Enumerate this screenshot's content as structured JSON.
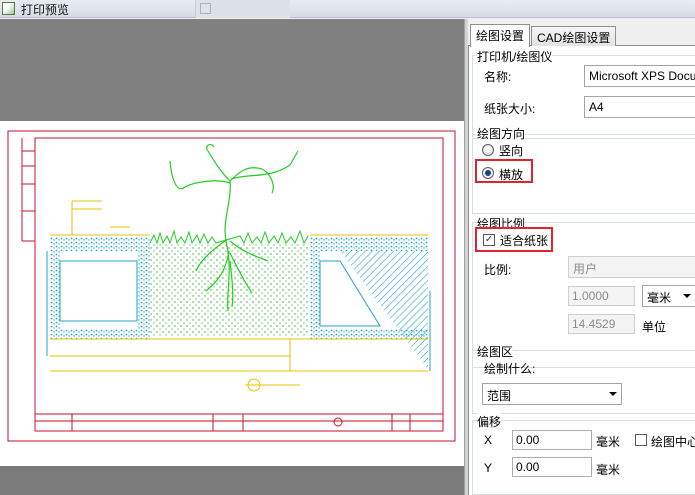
{
  "window": {
    "title": "打印预览",
    "ghost_title": ""
  },
  "tabs": [
    {
      "label": "绘图设置"
    },
    {
      "label": "CAD绘图设置"
    }
  ],
  "printer": {
    "group_title": "打印机/绘图仪",
    "name_label": "名称:",
    "name_value": "Microsoft XPS Docu",
    "paper_label": "纸张大小:",
    "paper_value": "A4"
  },
  "orientation": {
    "group_title": "绘图方向",
    "portrait_label": "竖向",
    "landscape_label": "横放",
    "selected": "横放"
  },
  "scale": {
    "group_title": "绘图比例",
    "fit_label": "适合纸张",
    "fit_checked": true,
    "ratio_label": "比例:",
    "ratio_value": "用户",
    "value1": "1.0000",
    "unit_value": "毫米",
    "value2": "14.4529",
    "unit_label": "单位"
  },
  "plot_area": {
    "group_title": "绘图区",
    "what_label": "绘制什么:",
    "what_value": "范围"
  },
  "offset": {
    "group_title": "偏移",
    "x_label": "X",
    "x_value": "0.00",
    "x_unit": "毫米",
    "y_label": "Y",
    "y_value": "0.00",
    "y_unit": "毫米",
    "center_label": "绘图中心"
  },
  "colors": {
    "highlight": "#e0242b",
    "drawing_border": "#c8102e",
    "tree": "#22cc22",
    "hatch": "#22a6c8",
    "dim": "#e8c200"
  }
}
